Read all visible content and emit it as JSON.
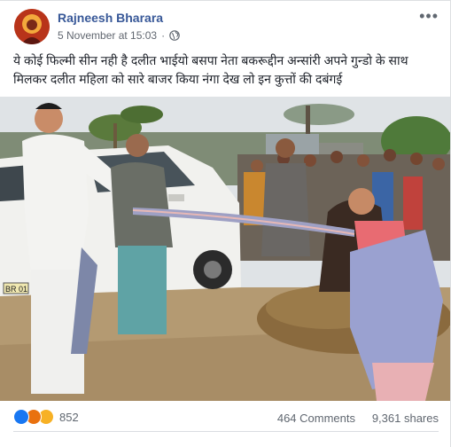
{
  "post": {
    "author": "Rajneesh Bharara",
    "timestamp": "5 November at 15:03",
    "privacy_icon": "globe-icon",
    "more_icon": "ellipsis-icon",
    "message": "ये कोई फिल्मी सीन नही है दलीत भाईयो बसपा नेता बकरूद्दीन अन्सांरी अपने गुन्डो के साथ मिलकर दलीत महिला को सारे बाजर किया नंगा देख लो इन कुत्तों की दबंगई"
  },
  "photo": {
    "car_plate_text": "BR 01",
    "colors": {
      "sky": "#dfe3e6",
      "ground": "#b49a72",
      "car": "#f1f1ee",
      "woman_top": "#e86b72"
    }
  },
  "stats": {
    "reaction_icons": [
      "like-reaction-icon",
      "angry-reaction-icon",
      "sad-reaction-icon"
    ],
    "reaction_count": "852",
    "comments": "464 Comments",
    "shares": "9,361 shares"
  },
  "colors": {
    "author": "#385898",
    "meta": "#616770",
    "like": "#1877f2"
  }
}
